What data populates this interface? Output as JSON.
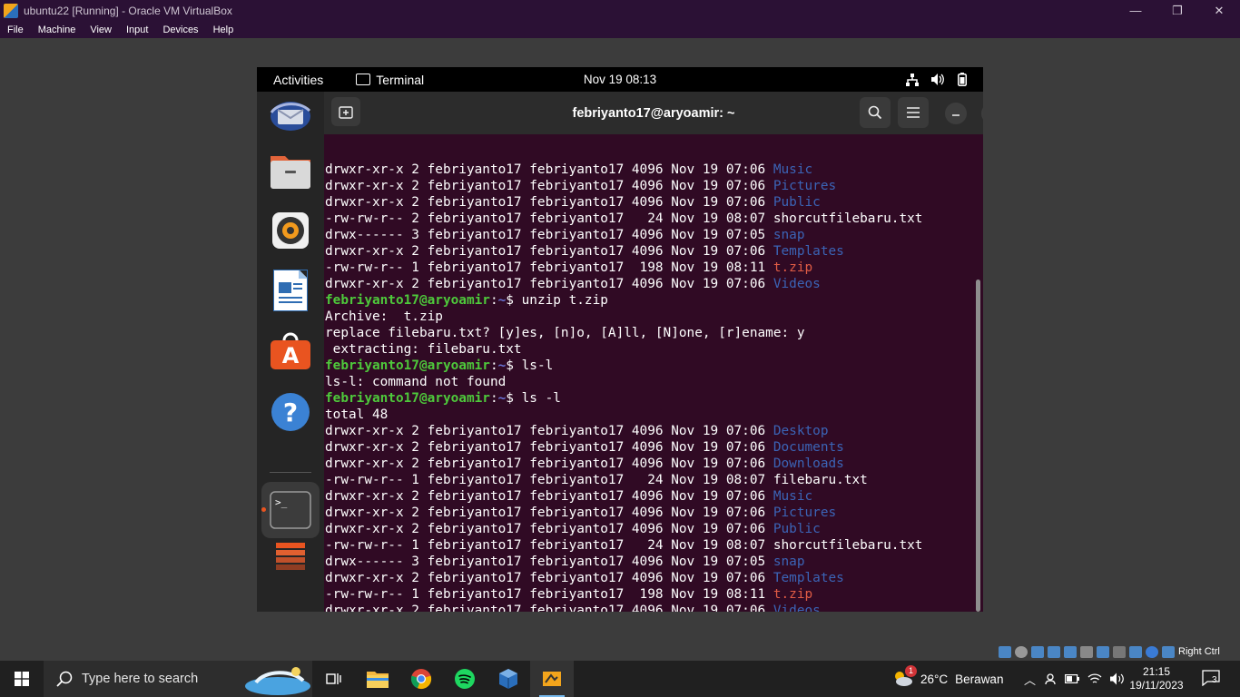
{
  "vbox": {
    "title": "ubuntu22 [Running] - Oracle VM VirtualBox",
    "menu": [
      "File",
      "Machine",
      "View",
      "Input",
      "Devices",
      "Help"
    ],
    "minimize": "—",
    "maximize": "❐",
    "close": "✕",
    "host_key": "Right Ctrl"
  },
  "ubuntu": {
    "activities": "Activities",
    "app_name": "Terminal",
    "clock": "Nov 19  08:13"
  },
  "terminal": {
    "title": "febriyanto17@aryoamir: ~",
    "lines": [
      [
        {
          "t": "drwxr-xr-x 2 febriyanto17 febriyanto17 4096 Nov 19 07:06 ",
          "c": ""
        },
        {
          "t": "Music",
          "c": "dir"
        }
      ],
      [
        {
          "t": "drwxr-xr-x 2 febriyanto17 febriyanto17 4096 Nov 19 07:06 ",
          "c": ""
        },
        {
          "t": "Pictures",
          "c": "dir"
        }
      ],
      [
        {
          "t": "drwxr-xr-x 2 febriyanto17 febriyanto17 4096 Nov 19 07:06 ",
          "c": ""
        },
        {
          "t": "Public",
          "c": "dir"
        }
      ],
      [
        {
          "t": "-rw-rw-r-- 2 febriyanto17 febriyanto17   24 Nov 19 08:07 shorcutfilebaru.txt",
          "c": ""
        }
      ],
      [
        {
          "t": "drwx------ 3 febriyanto17 febriyanto17 4096 Nov 19 07:05 ",
          "c": ""
        },
        {
          "t": "snap",
          "c": "dir"
        }
      ],
      [
        {
          "t": "drwxr-xr-x 2 febriyanto17 febriyanto17 4096 Nov 19 07:06 ",
          "c": ""
        },
        {
          "t": "Templates",
          "c": "dir"
        }
      ],
      [
        {
          "t": "-rw-rw-r-- 1 febriyanto17 febriyanto17  198 Nov 19 08:11 ",
          "c": ""
        },
        {
          "t": "t.zip",
          "c": "zip"
        }
      ],
      [
        {
          "t": "drwxr-xr-x 2 febriyanto17 febriyanto17 4096 Nov 19 07:06 ",
          "c": ""
        },
        {
          "t": "Videos",
          "c": "dir"
        }
      ],
      [
        {
          "t": "febriyanto17@aryoamir",
          "c": "user"
        },
        {
          "t": ":",
          "c": ""
        },
        {
          "t": "~",
          "c": "path"
        },
        {
          "t": "$ unzip t.zip",
          "c": ""
        }
      ],
      [
        {
          "t": "Archive:  t.zip",
          "c": ""
        }
      ],
      [
        {
          "t": "replace filebaru.txt? [y]es, [n]o, [A]ll, [N]one, [r]ename: y",
          "c": ""
        }
      ],
      [
        {
          "t": " extracting: filebaru.txt",
          "c": ""
        }
      ],
      [
        {
          "t": "febriyanto17@aryoamir",
          "c": "user"
        },
        {
          "t": ":",
          "c": ""
        },
        {
          "t": "~",
          "c": "path"
        },
        {
          "t": "$ ls-l",
          "c": ""
        }
      ],
      [
        {
          "t": "ls-l: command not found",
          "c": ""
        }
      ],
      [
        {
          "t": "febriyanto17@aryoamir",
          "c": "user"
        },
        {
          "t": ":",
          "c": ""
        },
        {
          "t": "~",
          "c": "path"
        },
        {
          "t": "$ ls -l",
          "c": ""
        }
      ],
      [
        {
          "t": "total 48",
          "c": ""
        }
      ],
      [
        {
          "t": "drwxr-xr-x 2 febriyanto17 febriyanto17 4096 Nov 19 07:06 ",
          "c": ""
        },
        {
          "t": "Desktop",
          "c": "dir"
        }
      ],
      [
        {
          "t": "drwxr-xr-x 2 febriyanto17 febriyanto17 4096 Nov 19 07:06 ",
          "c": ""
        },
        {
          "t": "Documents",
          "c": "dir"
        }
      ],
      [
        {
          "t": "drwxr-xr-x 2 febriyanto17 febriyanto17 4096 Nov 19 07:06 ",
          "c": ""
        },
        {
          "t": "Downloads",
          "c": "dir"
        }
      ],
      [
        {
          "t": "-rw-rw-r-- 1 febriyanto17 febriyanto17   24 Nov 19 08:07 filebaru.txt",
          "c": ""
        }
      ],
      [
        {
          "t": "drwxr-xr-x 2 febriyanto17 febriyanto17 4096 Nov 19 07:06 ",
          "c": ""
        },
        {
          "t": "Music",
          "c": "dir"
        }
      ],
      [
        {
          "t": "drwxr-xr-x 2 febriyanto17 febriyanto17 4096 Nov 19 07:06 ",
          "c": ""
        },
        {
          "t": "Pictures",
          "c": "dir"
        }
      ],
      [
        {
          "t": "drwxr-xr-x 2 febriyanto17 febriyanto17 4096 Nov 19 07:06 ",
          "c": ""
        },
        {
          "t": "Public",
          "c": "dir"
        }
      ],
      [
        {
          "t": "-rw-rw-r-- 1 febriyanto17 febriyanto17   24 Nov 19 08:07 shorcutfilebaru.txt",
          "c": ""
        }
      ],
      [
        {
          "t": "drwx------ 3 febriyanto17 febriyanto17 4096 Nov 19 07:05 ",
          "c": ""
        },
        {
          "t": "snap",
          "c": "dir"
        }
      ],
      [
        {
          "t": "drwxr-xr-x 2 febriyanto17 febriyanto17 4096 Nov 19 07:06 ",
          "c": ""
        },
        {
          "t": "Templates",
          "c": "dir"
        }
      ],
      [
        {
          "t": "-rw-rw-r-- 1 febriyanto17 febriyanto17  198 Nov 19 08:11 ",
          "c": ""
        },
        {
          "t": "t.zip",
          "c": "zip"
        }
      ],
      [
        {
          "t": "drwxr-xr-x 2 febriyanto17 febriyanto17 4096 Nov 19 07:06 ",
          "c": ""
        },
        {
          "t": "Videos",
          "c": "dir"
        }
      ],
      [
        {
          "t": "febriyanto17@aryoamir",
          "c": "user"
        },
        {
          "t": ":",
          "c": ""
        },
        {
          "t": "~",
          "c": "path"
        },
        {
          "t": "$ ",
          "c": ""
        }
      ]
    ]
  },
  "taskbar": {
    "search_placeholder": "Type here to search",
    "weather_temp": "26°C",
    "weather_desc": "Berawan",
    "weather_badge": "1",
    "time": "21:15",
    "date": "19/11/2023",
    "notifications": "3"
  },
  "colors": {
    "terminal_bg": "#300a24",
    "prompt_user": "#4ec93b",
    "prompt_path": "#6a75d8",
    "directory": "#3b64b6",
    "zip": "#e05c45",
    "ubuntu_accent": "#e95420"
  }
}
